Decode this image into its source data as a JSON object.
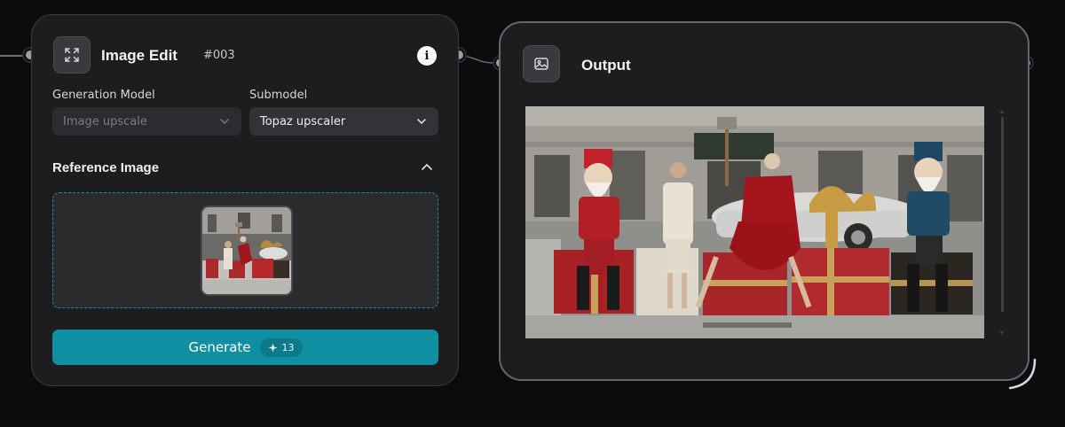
{
  "edit_node": {
    "title": "Image Edit",
    "id": "#003",
    "icon": "expand-icon",
    "info_icon": "info-icon",
    "fields": {
      "model_label": "Generation Model",
      "model_value": "Image upscale",
      "submodel_label": "Submodel",
      "submodel_value": "Topaz upscaler"
    },
    "reference": {
      "title": "Reference Image",
      "collapse_icon": "chevron-up-icon"
    },
    "generate": {
      "label": "Generate",
      "credit_icon": "sparkle-icon",
      "credits": "13"
    }
  },
  "output_node": {
    "title": "Output",
    "icon": "image-icon"
  },
  "colors": {
    "accent": "#0f8fa1",
    "card_bg": "#1d1d20",
    "page_bg": "#0c0c0e"
  }
}
